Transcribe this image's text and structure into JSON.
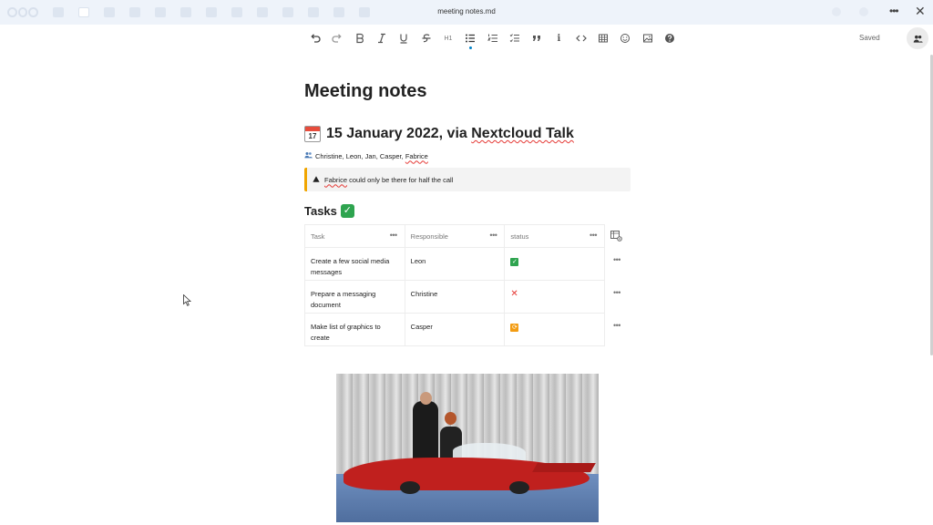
{
  "header": {
    "doc_title": "meeting notes.md",
    "menu_glyph": "•••",
    "close_glyph": "✕"
  },
  "toolbar": {
    "heading_label": "H1",
    "italic_info_label": "i",
    "saved_label": "Saved",
    "icons": [
      "undo-icon",
      "redo-icon",
      "bold-icon",
      "italic-icon",
      "underline-icon",
      "strikethrough-icon",
      "heading-icon",
      "bullet-list-icon",
      "ordered-list-icon",
      "task-list-icon",
      "blockquote-icon",
      "info-box-icon",
      "code-block-icon",
      "table-icon",
      "emoji-icon",
      "image-icon",
      "help-icon"
    ]
  },
  "document": {
    "title": "Meeting notes",
    "meeting_heading_day": "17",
    "meeting_heading_text": "15 January 2022, via ",
    "meeting_heading_link": "Nextcloud Talk",
    "attendees_text": "Christine, Leon, Jan, Casper, ",
    "attendees_last": "Fabrice",
    "callout_name": "Fabrice",
    "callout_text": " could only be there for half the call",
    "tasks_heading": "Tasks",
    "tasks_heading_emoji": "✓"
  },
  "table": {
    "headers": [
      "Task",
      "Responsible",
      "status"
    ],
    "col_menu_glyph": "•••",
    "rows": [
      {
        "task": "Create a few social media messages",
        "responsible": "Leon",
        "status": "done"
      },
      {
        "task": "Prepare a messaging document",
        "responsible": "Christine",
        "status": "failed"
      },
      {
        "task": "Make list of graphics to create",
        "responsible": "Casper",
        "status": "in-progress"
      }
    ],
    "status_glyphs": {
      "done": "✓",
      "failed": "✕",
      "in_progress": "⟳"
    }
  },
  "colors": {
    "accent": "#0082c9",
    "header_bg": "#eef3fa",
    "callout_border": "#f0a500",
    "status_done": "#2ea44f",
    "status_failed": "#e53935",
    "status_in_progress": "#f39c12",
    "car_red": "#c0201e"
  }
}
